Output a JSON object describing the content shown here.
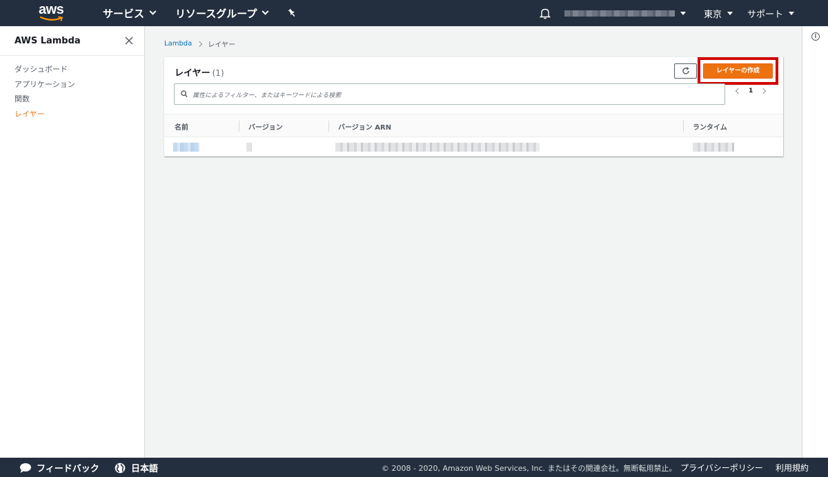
{
  "topnav": {
    "logo_text": "aws",
    "services_label": "サービス",
    "resource_groups_label": "リソースグループ",
    "region_label": "東京",
    "support_label": "サポート"
  },
  "sidebar": {
    "title": "AWS Lambda",
    "items": [
      {
        "label": "ダッシュボード",
        "active": false
      },
      {
        "label": "アプリケーション",
        "active": false
      },
      {
        "label": "関数",
        "active": false
      },
      {
        "label": "レイヤー",
        "active": true
      }
    ]
  },
  "breadcrumb": {
    "root": "Lambda",
    "current": "レイヤー"
  },
  "panel": {
    "title": "レイヤー",
    "count": "(1)",
    "create_button": "レイヤーの作成",
    "search_placeholder": "属性によるフィルター、またはキーワードによる検索",
    "page_number": "1",
    "columns": [
      "名前",
      "バージョン",
      "バージョン ARN",
      "ランタイム"
    ]
  },
  "footer": {
    "feedback": "フィードバック",
    "language": "日本語",
    "copyright": "© 2008 - 2020, Amazon Web Services, Inc. またはその関連会社。無断転用禁止。",
    "privacy": "プライバシーポリシー",
    "terms": "利用規約"
  },
  "colors": {
    "nav_bg": "#232f3e",
    "accent_orange": "#ec7211",
    "link_blue": "#0073bb",
    "highlight_red": "#d00000"
  }
}
